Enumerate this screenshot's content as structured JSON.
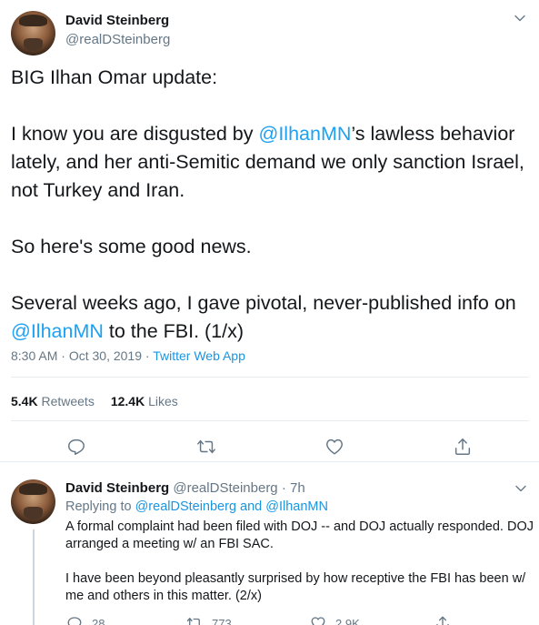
{
  "tweet": {
    "author_name": "David Steinberg",
    "author_handle": "@realDSteinberg",
    "text_line1": "BIG Ilhan Omar update:",
    "text_p2_a": "I know you are disgusted by ",
    "text_p2_mention": "@IlhanMN",
    "text_p2_b": "’s lawless behavior lately, and her anti-Semitic demand we only sanction Israel, not Turkey and Iran.",
    "text_p3": "So here's some good news.",
    "text_p4_a": "Several weeks ago, I gave pivotal, never-published info on ",
    "text_p4_mention": "@IlhanMN",
    "text_p4_b": " to the FBI. (1/x)",
    "time": "8:30 AM",
    "date_sep": " · ",
    "date": "Oct 30, 2019",
    "app_sep": " · ",
    "app": "Twitter Web App",
    "retweets_count": "5.4K",
    "retweets_label": " Retweets",
    "likes_count": "12.4K",
    "likes_label": " Likes"
  },
  "reply": {
    "author_name": "David Steinberg",
    "author_handle": " @realDSteinberg",
    "age": " · 7h",
    "replying_prefix": "Replying to ",
    "replying_to": "@realDSteinberg and @IlhanMN",
    "text_p1": "A formal complaint had been filed with DOJ -- and DOJ actually responded. DOJ arranged a meeting w/ an FBI SAC.",
    "text_p2": "I have been beyond pleasantly surprised by how receptive the FBI has been w/ me and others in this matter. (2/x)",
    "reply_count": "28",
    "retweet_count": "773",
    "like_count": "2.9K"
  },
  "icons": {
    "chevron": "chevron-down-icon",
    "reply": "reply-icon",
    "retweet": "retweet-icon",
    "like": "heart-icon",
    "share": "share-icon"
  },
  "colors": {
    "link": "#1da1f2",
    "secondary": "#657786",
    "divider": "#e6ecf0"
  }
}
